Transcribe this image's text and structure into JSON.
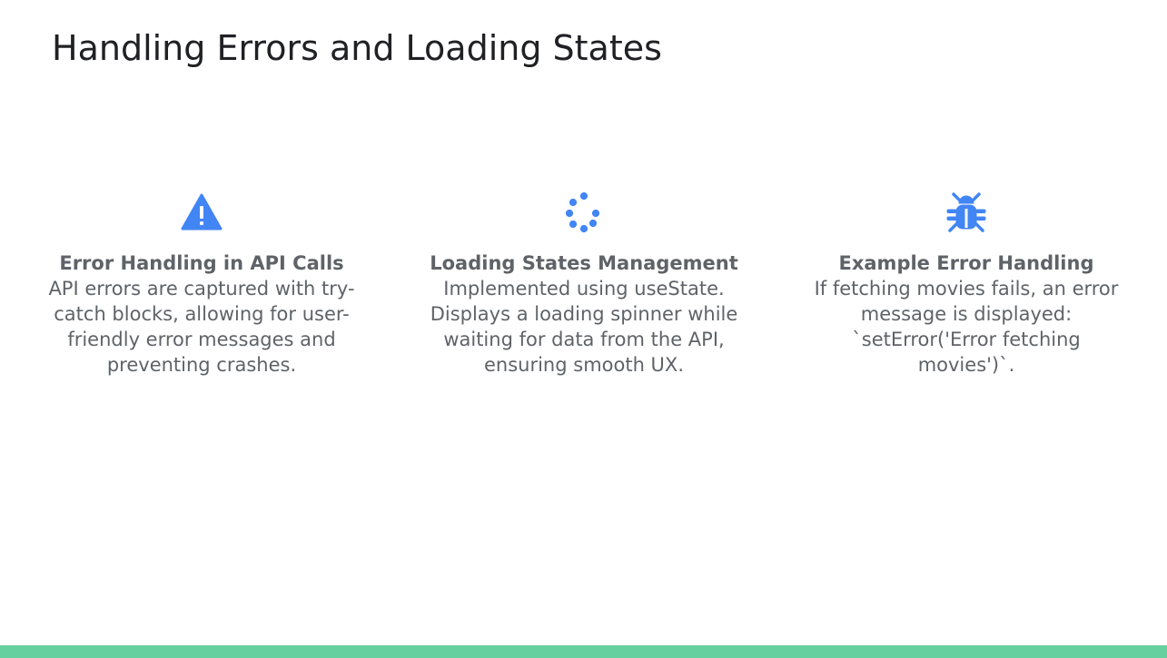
{
  "slide": {
    "title": "Handling Errors and Loading States",
    "accent_color": "#4285f4",
    "bar_color": "#66d19e"
  },
  "cards": [
    {
      "icon": "warning-icon",
      "title": "Error Handling in API Calls",
      "text": "API errors are captured with try-catch blocks, allowing for user-friendly error messages and preventing crashes."
    },
    {
      "icon": "loading-spinner-icon",
      "title": "Loading States Management",
      "text": "Implemented using useState. Displays a loading spinner while waiting for data from the API, ensuring smooth UX."
    },
    {
      "icon": "bug-icon",
      "title": "Example Error Handling",
      "text": "If fetching movies fails, an error message is displayed: `setError('Error fetching movies')`."
    }
  ]
}
